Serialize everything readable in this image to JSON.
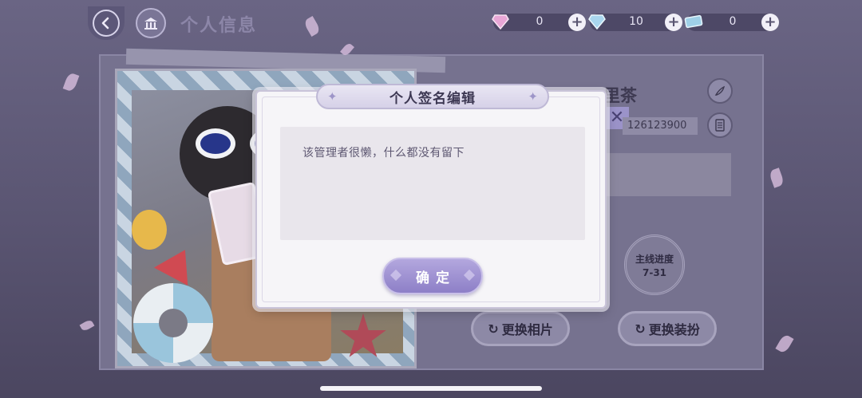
{
  "header": {
    "title": "个人信息"
  },
  "currencies": [
    {
      "icon": "pink-diamond-icon",
      "value": "0"
    },
    {
      "icon": "blue-diamond-icon",
      "value": "10"
    },
    {
      "icon": "ticket-icon",
      "value": "0"
    }
  ],
  "profile": {
    "name_visible": "里茶",
    "id_visible": "126123900",
    "main_progress_label": "主线进度",
    "main_progress_value": "7-31",
    "change_photo_label": "更换相片",
    "change_outfit_label": "更换装扮"
  },
  "modal": {
    "title": "个人签名编辑",
    "signature_text": "该管理者很懒，什么都没有留下",
    "confirm_label": "确定"
  },
  "colors": {
    "accent": "#8d7fc7",
    "modal_bg": "#f6f5f8",
    "input_bg": "#e9e6ec"
  }
}
